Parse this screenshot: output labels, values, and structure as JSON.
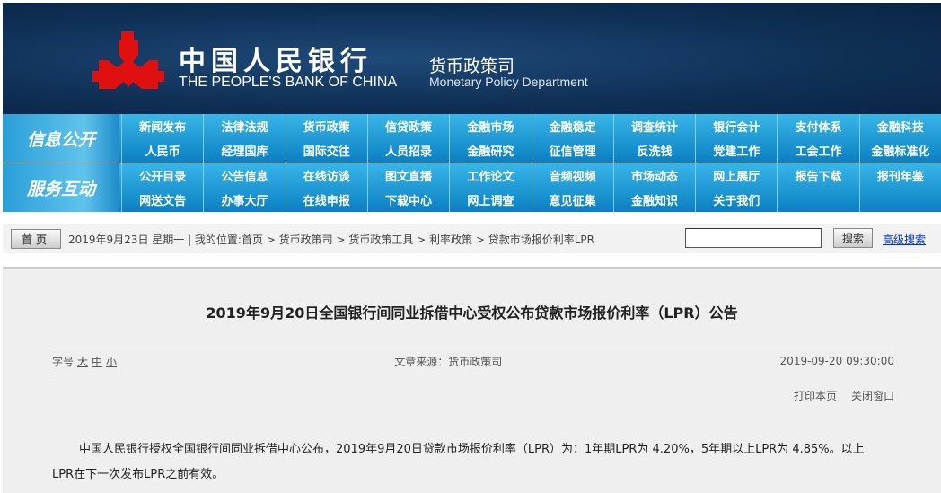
{
  "header": {
    "cn_name": "中国人民银行",
    "en_name": "THE PEOPLE'S BANK OF CHINA",
    "dept_cn": "货币政策司",
    "dept_en": "Monetary Policy Department"
  },
  "nav": [
    {
      "label": "信息公开",
      "items": [
        "新闻发布",
        "法律法规",
        "货币政策",
        "信贷政策",
        "金融市场",
        "金融稳定",
        "调查统计",
        "银行会计",
        "支付体系",
        "金融科技",
        "人民币",
        "经理国库",
        "国际交往",
        "人员招录",
        "金融研究",
        "征信管理",
        "反洗钱",
        "党建工作",
        "工会工作",
        "金融标准化"
      ]
    },
    {
      "label": "服务互动",
      "items": [
        "公开目录",
        "公告信息",
        "在线访谈",
        "图文直播",
        "工作论文",
        "音频视频",
        "市场动态",
        "网上展厅",
        "报告下载",
        "报刊年鉴",
        "网送文告",
        "办事大厅",
        "在线申报",
        "下载中心",
        "网上调查",
        "意见征集",
        "金融知识",
        "关于我们",
        "",
        ""
      ]
    }
  ],
  "crumb": {
    "home": "首页",
    "date": "2019年9月23日 星期一 | 我的位置:",
    "path": "首页 > 货币政策司 > 货币政策工具 > 利率政策 > 贷款市场报价利率LPR",
    "search_btn": "搜索",
    "advanced": "高级搜索",
    "search_value": ""
  },
  "article": {
    "title": "2019年9月20日全国银行间同业拆借中心受权公布贷款市场报价利率（LPR）公告",
    "font_label": "字号",
    "font_large": "大",
    "font_medium": "中",
    "font_small": "小",
    "source": "文章来源：货币政策司",
    "datetime": "2019-09-20 09:30:00",
    "print": "打印本页",
    "close": "关闭窗口",
    "body": "中国人民银行授权全国银行间同业拆借中心公布，2019年9月20日贷款市场报价利率（LPR）为：1年期LPR为 4.20%，5年期以上LPR为 4.85%。以上LPR在下一次发布LPR之前有效。"
  }
}
